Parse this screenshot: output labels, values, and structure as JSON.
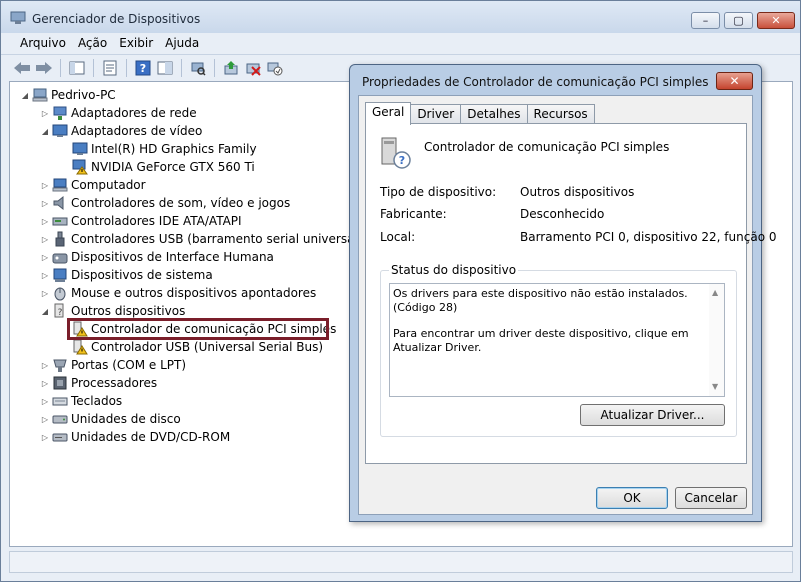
{
  "window": {
    "title": "Gerenciador de Dispositivos",
    "minimize": "–",
    "maximize": "▢",
    "close": "✕"
  },
  "menu": [
    "Arquivo",
    "Ação",
    "Exibir",
    "Ajuda"
  ],
  "tree": {
    "root": "Pedrivo-PC",
    "items": [
      {
        "label": "Adaptadores de rede",
        "icon": "network-icon",
        "expanded": false
      },
      {
        "label": "Adaptadores de vídeo",
        "icon": "display-icon",
        "expanded": true
      },
      {
        "label": "Intel(R) HD Graphics Family",
        "icon": "display-icon",
        "child": true
      },
      {
        "label": "NVIDIA GeForce GTX 560 Ti",
        "icon": "warning-display-icon",
        "child": true
      },
      {
        "label": "Computador",
        "icon": "computer-icon",
        "expanded": false
      },
      {
        "label": "Controladores de som, vídeo e jogos",
        "icon": "speaker-icon",
        "expanded": false
      },
      {
        "label": "Controladores IDE ATA/ATAPI",
        "icon": "ide-icon",
        "expanded": false
      },
      {
        "label": "Controladores USB (barramento serial universal)",
        "icon": "usb-icon",
        "expanded": false
      },
      {
        "label": "Dispositivos de Interface Humana",
        "icon": "hid-icon",
        "expanded": false
      },
      {
        "label": "Dispositivos de sistema",
        "icon": "system-icon",
        "expanded": false
      },
      {
        "label": "Mouse e outros dispositivos apontadores",
        "icon": "mouse-icon",
        "expanded": false
      },
      {
        "label": "Outros dispositivos",
        "icon": "unknown-device-icon",
        "expanded": true
      },
      {
        "label": "Controlador de comunicação PCI simples",
        "icon": "warning-device-icon",
        "child": true
      },
      {
        "label": "Controlador USB (Universal Serial Bus)",
        "icon": "warning-device-icon",
        "child": true
      },
      {
        "label": "Portas (COM e LPT)",
        "icon": "port-icon",
        "expanded": false
      },
      {
        "label": "Processadores",
        "icon": "processor-icon",
        "expanded": false
      },
      {
        "label": "Teclados",
        "icon": "keyboard-icon",
        "expanded": false
      },
      {
        "label": "Unidades de disco",
        "icon": "disk-icon",
        "expanded": false
      },
      {
        "label": "Unidades de DVD/CD-ROM",
        "icon": "dvd-icon",
        "expanded": false
      }
    ]
  },
  "dialog": {
    "title": "Propriedades de Controlador de comunicação PCI simples",
    "close": "✕",
    "tabs": [
      "Geral",
      "Driver",
      "Detalhes",
      "Recursos"
    ],
    "active_tab": "Geral",
    "device_name": "Controlador de comunicação PCI simples",
    "props": {
      "type_label": "Tipo de dispositivo:",
      "type_value": "Outros dispositivos",
      "maker_label": "Fabricante:",
      "maker_value": "Desconhecido",
      "location_label": "Local:",
      "location_value": "Barramento PCI 0, dispositivo 22, função 0"
    },
    "status_group": "Status do dispositivo",
    "status_line1": "Os drivers para este dispositivo não estão instalados. (Código 28)",
    "status_line2": "Para encontrar um driver deste dispositivo, clique em Atualizar Driver.",
    "update_button": "Atualizar Driver...",
    "ok_button": "OK",
    "cancel_button": "Cancelar"
  }
}
